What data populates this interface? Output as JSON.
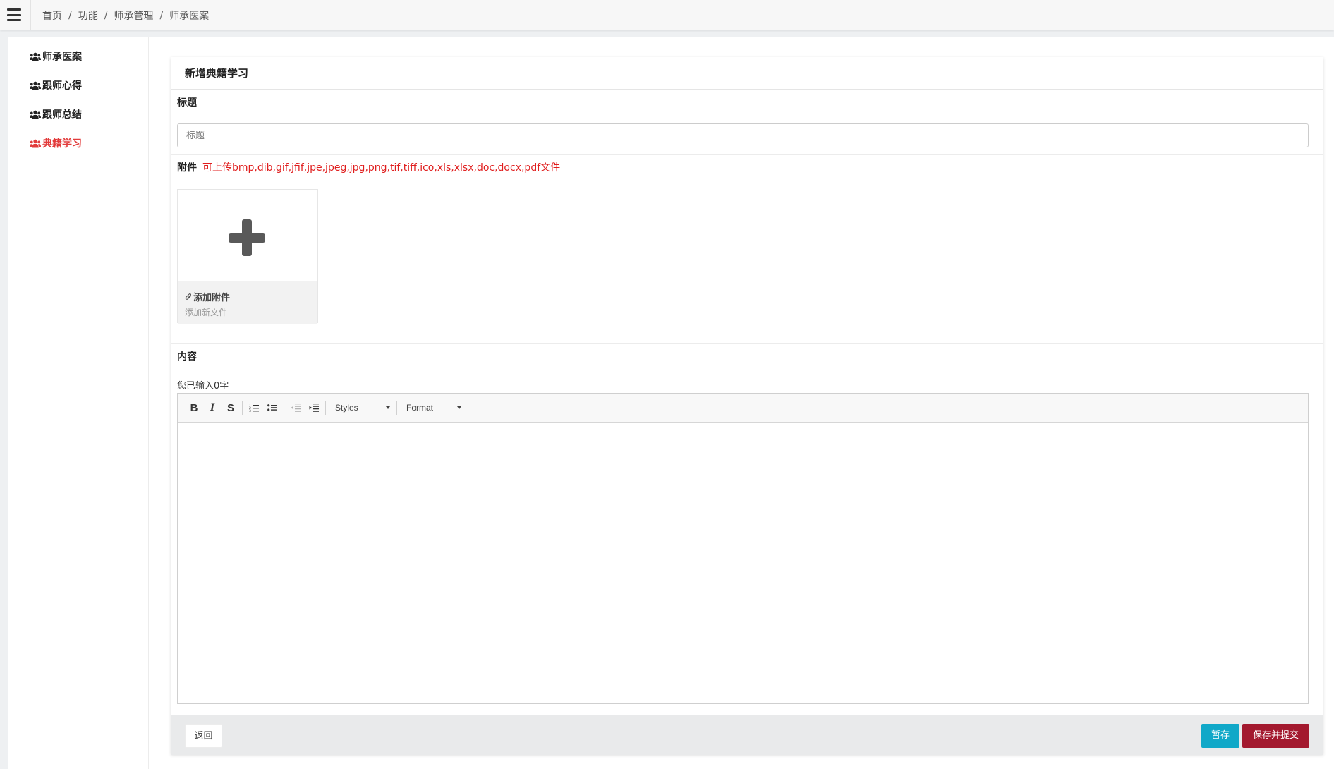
{
  "breadcrumb": {
    "items": [
      "首页",
      "功能",
      "师承管理",
      "师承医案"
    ],
    "separator": "/"
  },
  "sidebar": {
    "items": [
      {
        "label": "师承医案",
        "icon": "users-icon",
        "active": false
      },
      {
        "label": "跟师心得",
        "icon": "users-icon",
        "active": false
      },
      {
        "label": "跟师总结",
        "icon": "users-icon",
        "active": false
      },
      {
        "label": "典籍学习",
        "icon": "users-icon",
        "active": true
      }
    ],
    "active_color": "#e23b3b"
  },
  "form": {
    "card_title": "新增典籍学习",
    "title_label": "标题",
    "title_placeholder": "标题",
    "title_value": "",
    "attachment_label": "附件",
    "attachment_hint": "可上传bmp,dib,gif,jfif,jpe,jpeg,jpg,png,tif,tiff,ico,xls,xlsx,doc,docx,pdf文件",
    "upload": {
      "title": "添加附件",
      "subtitle": "添加新文件"
    },
    "content_label": "内容",
    "char_count": "您已输入0字"
  },
  "editor": {
    "toolbar": {
      "bold": "B",
      "italic": "I",
      "strike": "S",
      "styles_label": "Styles",
      "format_label": "Format"
    },
    "content": ""
  },
  "footer": {
    "back_label": "返回",
    "draft_label": "暂存",
    "submit_label": "保存并提交"
  },
  "colors": {
    "draft_button": "#10a8c8",
    "submit_button": "#a3192e",
    "hint_text": "#e01e1e"
  }
}
